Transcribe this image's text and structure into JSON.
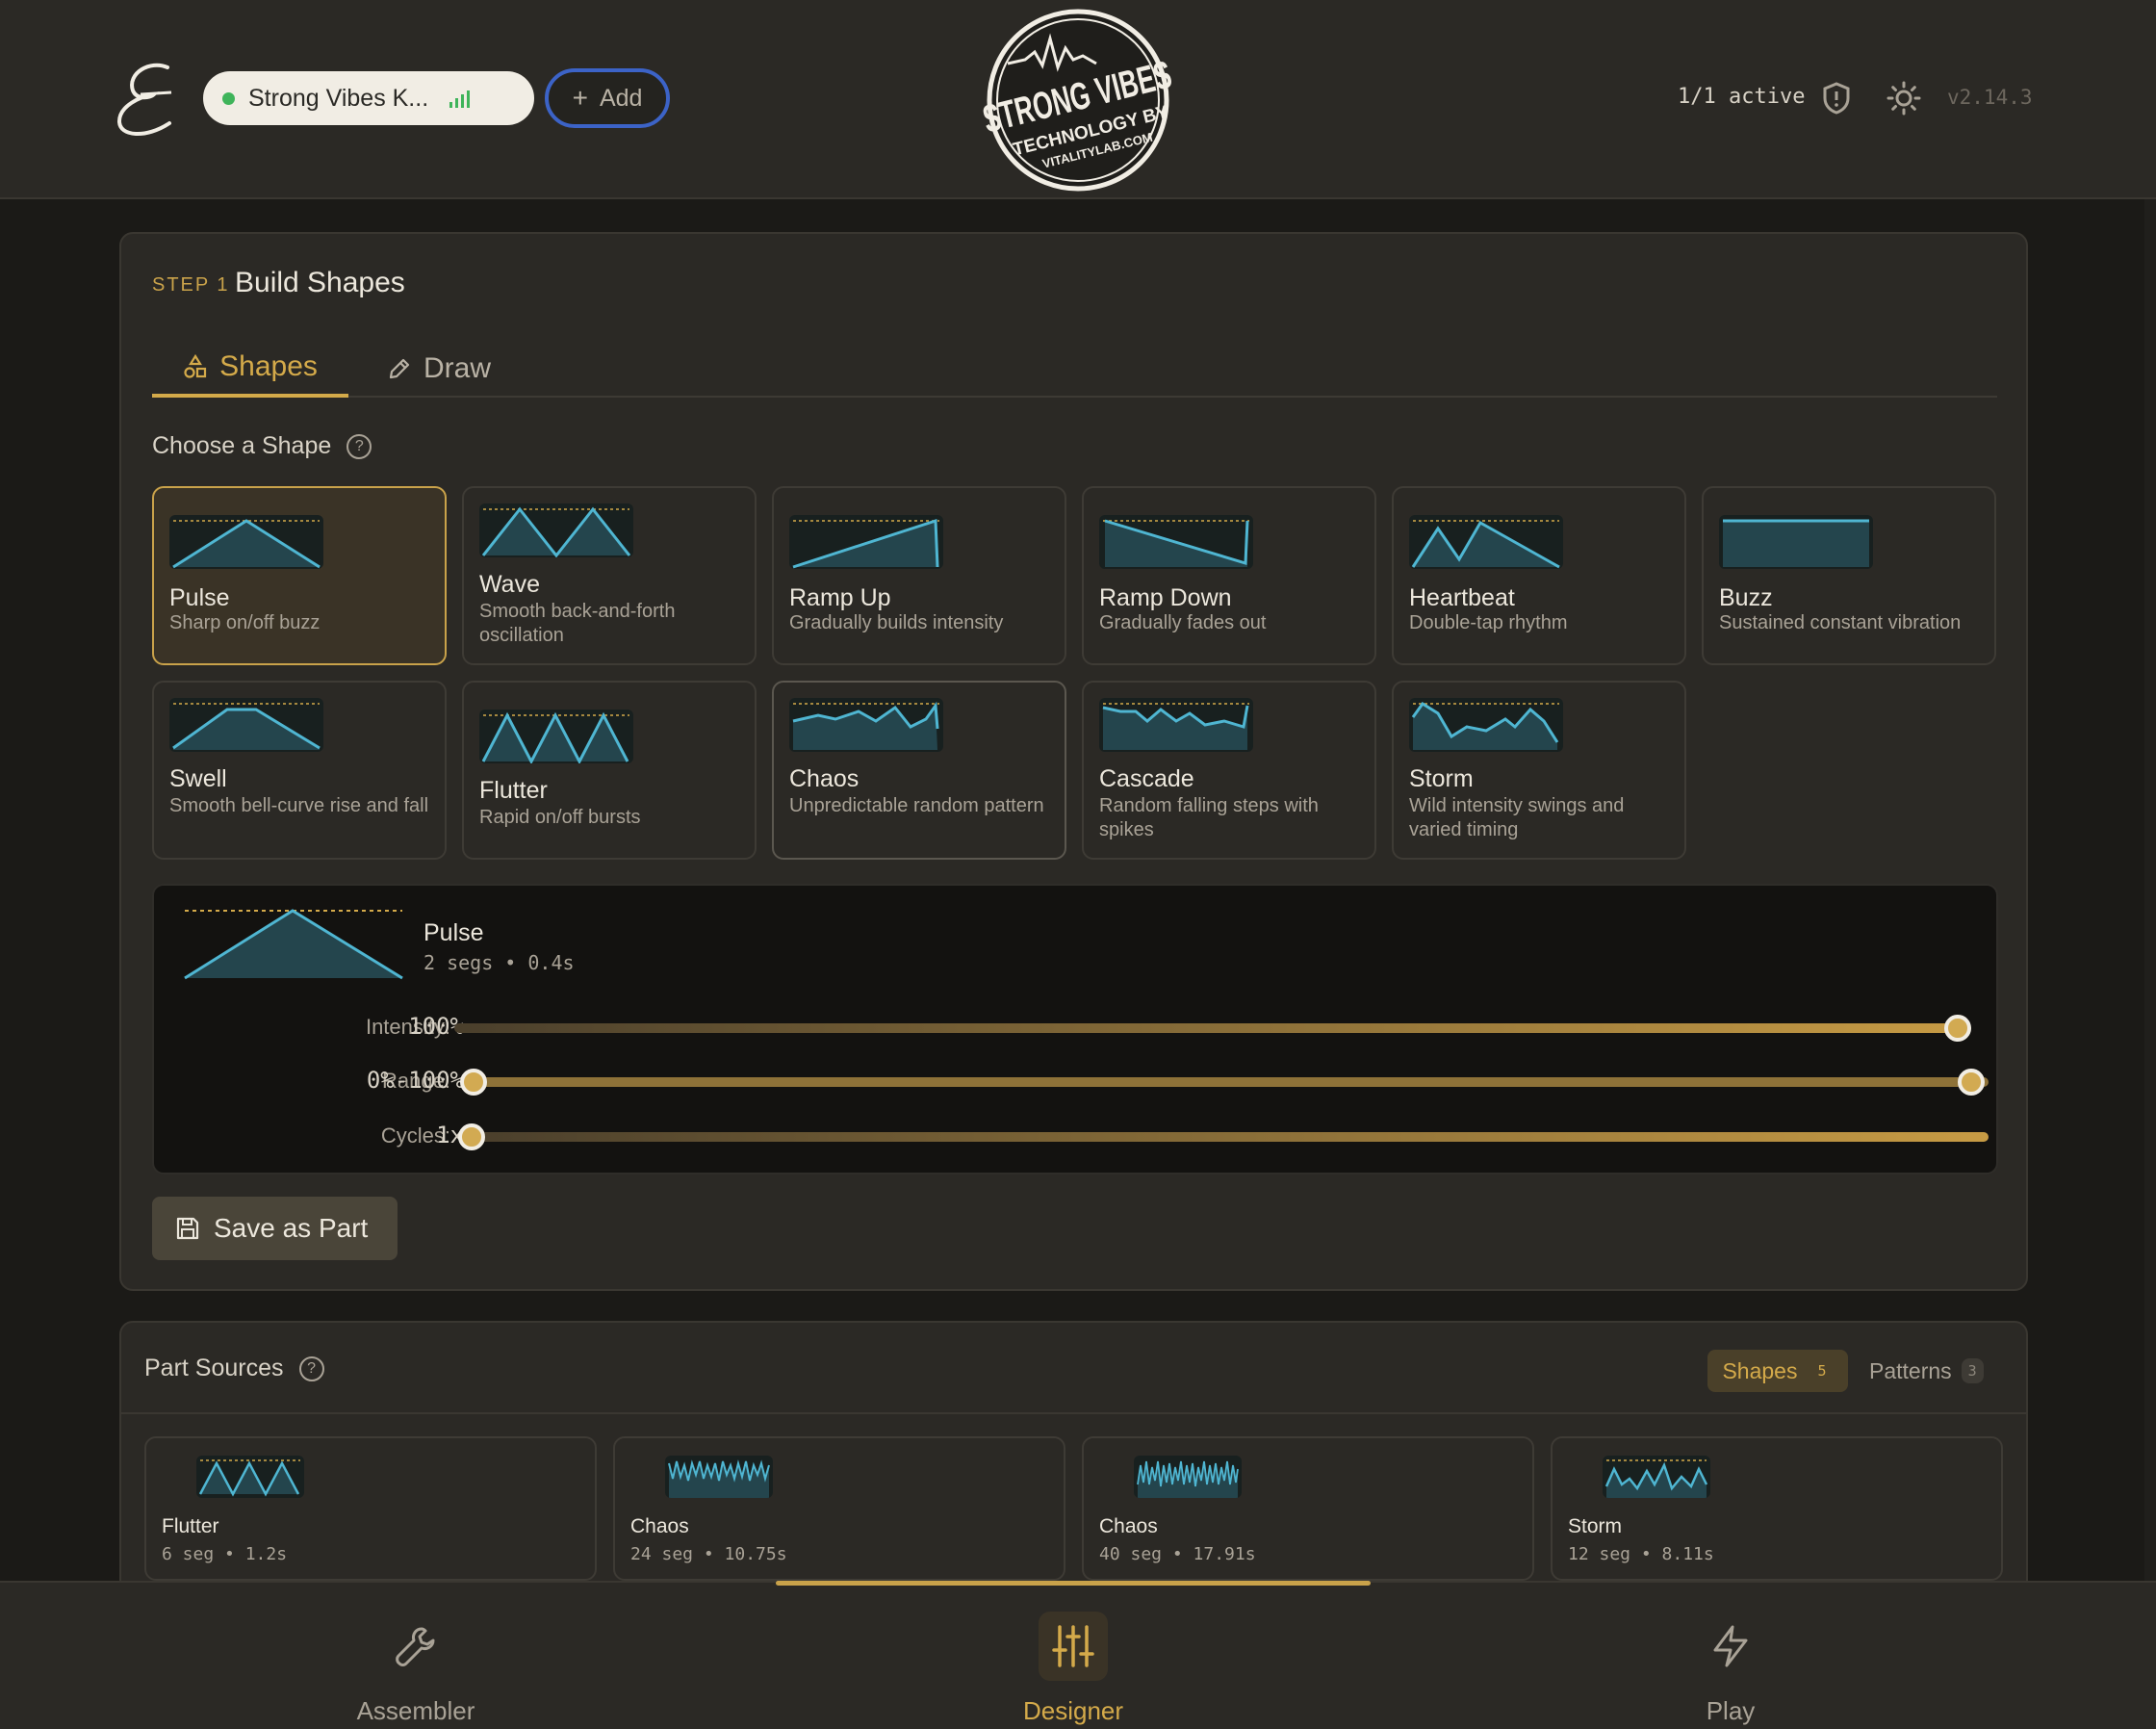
{
  "header": {
    "device_name": "Strong Vibes K...",
    "add_label": "Add",
    "brand": {
      "line1": "STRONG VIBES",
      "line2": "TECHNOLOGY BY",
      "line3": "VITALITYLAB.COM"
    },
    "active_count": "1/1 active",
    "version": "v2.14.3"
  },
  "step": {
    "label": "STEP 1",
    "title": "Build Shapes",
    "tabs": [
      {
        "label": "Shapes",
        "icon": "shapes-icon",
        "active": true
      },
      {
        "label": "Draw",
        "icon": "pencil-icon",
        "active": false
      }
    ],
    "choose_label": "Choose a Shape",
    "help": "?"
  },
  "shapes": [
    {
      "name": "Pulse",
      "desc": "Sharp on/off buzz",
      "selected": true
    },
    {
      "name": "Wave",
      "desc": "Smooth back-and-forth oscillation"
    },
    {
      "name": "Ramp Up",
      "desc": "Gradually builds intensity"
    },
    {
      "name": "Ramp Down",
      "desc": "Gradually fades out"
    },
    {
      "name": "Heartbeat",
      "desc": "Double-tap rhythm"
    },
    {
      "name": "Buzz",
      "desc": "Sustained constant vibration"
    },
    {
      "name": "Swell",
      "desc": "Smooth bell-curve rise and fall"
    },
    {
      "name": "Flutter",
      "desc": "Rapid on/off bursts"
    },
    {
      "name": "Chaos",
      "desc": "Unpredictable random pattern",
      "hover": true
    },
    {
      "name": "Cascade",
      "desc": "Random falling steps with spikes"
    },
    {
      "name": "Storm",
      "desc": "Wild intensity swings and varied timing"
    }
  ],
  "preview": {
    "name": "Pulse",
    "meta": "2 segs • 0.4s",
    "sliders": [
      {
        "label": "Intensity:",
        "value": "100%",
        "level": 1.0
      },
      {
        "label": "Range:",
        "value": "0%-100%",
        "low": 0.0,
        "high": 1.0
      },
      {
        "label": "Cycles:",
        "value": "1x",
        "level": 0.0
      }
    ]
  },
  "save_label": "Save as Part",
  "part_sources": {
    "title": "Part Sources",
    "tabs": [
      {
        "label": "Shapes",
        "count": "5",
        "active": true
      },
      {
        "label": "Patterns",
        "count": "3"
      }
    ],
    "items": [
      {
        "name": "Flutter",
        "meta": "6 seg • 1.2s"
      },
      {
        "name": "Chaos",
        "meta": "24 seg • 10.75s"
      },
      {
        "name": "Chaos",
        "meta": "40 seg • 17.91s"
      },
      {
        "name": "Storm",
        "meta": "12 seg • 8.11s"
      }
    ]
  },
  "nav": [
    {
      "label": "Assembler",
      "icon": "wrench-icon"
    },
    {
      "label": "Designer",
      "icon": "sliders-icon",
      "active": true
    },
    {
      "label": "Play",
      "icon": "lightning-icon"
    }
  ],
  "colors": {
    "accent": "#d4aa4a",
    "wave": "#4fb6d2",
    "bg": "#2b2925"
  }
}
